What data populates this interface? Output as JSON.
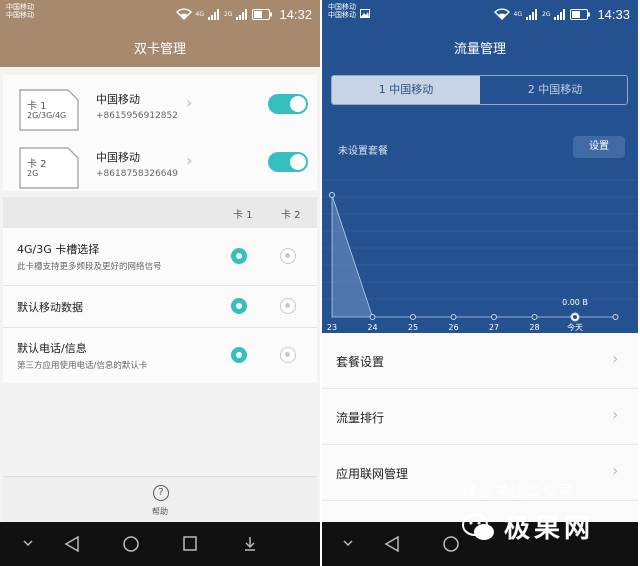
{
  "left": {
    "status": {
      "carrier_line1": "中国移动",
      "carrier_line2": "中国移动",
      "time": "14:32",
      "net1": "4G",
      "net2": "2G"
    },
    "title": "双卡管理",
    "sims": [
      {
        "name": "卡 1",
        "network": "2G/3G/4G",
        "carrier": "中国移动",
        "number": "+8615956912852",
        "enabled": true
      },
      {
        "name": "卡 2",
        "network": "2G",
        "carrier": "中国移动",
        "number": "+8618758326649",
        "enabled": true
      }
    ],
    "columns": {
      "card1": "卡 1",
      "card2": "卡 2"
    },
    "options": [
      {
        "title": "4G/3G 卡槽选择",
        "subtitle": "此卡槽支持更多频段及更好的网络信号",
        "selected": "card1"
      },
      {
        "title": "默认移动数据",
        "subtitle": "",
        "selected": "card1"
      },
      {
        "title": "默认电话/信息",
        "subtitle": "第三方应用使用电话/信息的默认卡",
        "selected": "card1"
      }
    ],
    "help_label": "帮助",
    "accent_color": "#35bfbf",
    "header_color": "#a78a6e"
  },
  "right": {
    "status": {
      "carrier_line1": "中国移动",
      "carrier_line2": "中国移动",
      "time": "14:33",
      "net1": "4G",
      "net2": "2G"
    },
    "title": "流量管理",
    "tabs": [
      {
        "label": "1 中国移动",
        "active": true
      },
      {
        "label": "2 中国移动",
        "active": false
      }
    ],
    "plan_status": "未设置套餐",
    "settings_button": "设置",
    "chart_data": {
      "type": "area",
      "categories": [
        "23",
        "24",
        "25",
        "26",
        "27",
        "28",
        "今天",
        ""
      ],
      "values": [
        1,
        0,
        0,
        0,
        0,
        0,
        0,
        0
      ],
      "current_value_label": "0.00 B",
      "highlight_index": 6
    },
    "menu": [
      {
        "label": "套餐设置"
      },
      {
        "label": "流量排行"
      },
      {
        "label": "应用联网管理"
      }
    ],
    "header_color": "#24518f"
  },
  "watermark": {
    "line1": "微信关注公众号",
    "brand": "极果网"
  }
}
